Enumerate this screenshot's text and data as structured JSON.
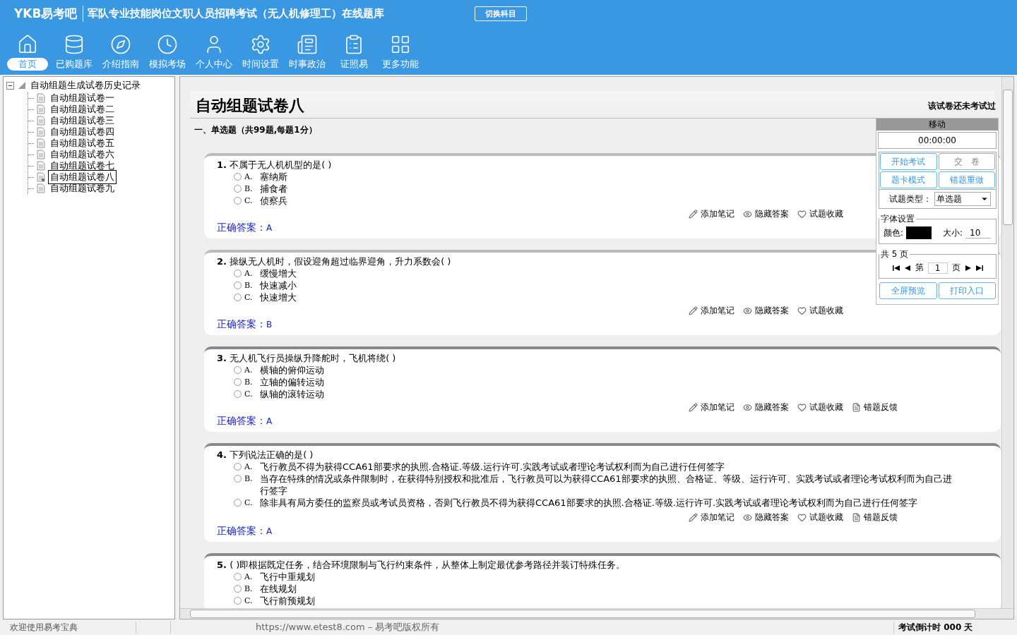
{
  "header": {
    "logo": "YKB易考吧",
    "title": "军队专业技能岗位文职人员招聘考试（无人机修理工）在线题库",
    "switch_button": "切换科目"
  },
  "nav": [
    {
      "label": "首页",
      "selected": true
    },
    {
      "label": "已购题库",
      "selected": false
    },
    {
      "label": "介绍指南",
      "selected": false
    },
    {
      "label": "模拟考场",
      "selected": false
    },
    {
      "label": "个人中心",
      "selected": false
    },
    {
      "label": "时间设置",
      "selected": false
    },
    {
      "label": "时事政治",
      "selected": false
    },
    {
      "label": "证照易",
      "selected": false
    },
    {
      "label": "更多功能",
      "selected": false
    }
  ],
  "tree": {
    "label": "自动组题生成试卷历史记录",
    "expanded": true,
    "children": [
      {
        "label": "自动组题试卷一",
        "selected": false
      },
      {
        "label": "自动组题试卷二",
        "selected": false
      },
      {
        "label": "自动组题试卷三",
        "selected": false
      },
      {
        "label": "自动组题试卷四",
        "selected": false
      },
      {
        "label": "自动组题试卷五",
        "selected": false
      },
      {
        "label": "自动组题试卷六",
        "selected": false
      },
      {
        "label": "自动组题试卷七",
        "selected": false
      },
      {
        "label": "自动组题试卷八",
        "selected": true
      },
      {
        "label": "自动组题试卷九",
        "selected": false
      }
    ]
  },
  "paper": {
    "title": "自动组题试卷八",
    "status": "该试卷还未考试过",
    "section": "一、单选题（共99题,每题1分）"
  },
  "questions": [
    {
      "number": "1.",
      "text": "不属于无人机机型的是( )",
      "options": [
        {
          "letter": "A.",
          "text": "塞纳斯",
          "selected": false
        },
        {
          "letter": "B.",
          "text": "捕食者",
          "selected": false
        },
        {
          "letter": "C.",
          "text": "侦察兵",
          "selected": false
        }
      ],
      "answer_label": "正确答案：",
      "answer": "A",
      "actions": [
        "添加笔记",
        "隐藏答案",
        "试题收藏"
      ]
    },
    {
      "number": "2.",
      "text": "操纵无人机时，假设迎角超过临界迎角，升力系数会( )",
      "options": [
        {
          "letter": "A.",
          "text": "缓慢增大",
          "selected": false
        },
        {
          "letter": "B.",
          "text": "快速减小",
          "selected": false
        },
        {
          "letter": "C.",
          "text": "快速增大",
          "selected": false
        }
      ],
      "answer_label": "正确答案：",
      "answer": "B",
      "actions": [
        "添加笔记",
        "隐藏答案",
        "试题收藏"
      ]
    },
    {
      "number": "3.",
      "text": "无人机飞行员操纵升降舵时，飞机将绕( )",
      "options": [
        {
          "letter": "A.",
          "text": "横轴的俯仰运动",
          "selected": false
        },
        {
          "letter": "B.",
          "text": "立轴的偏转运动",
          "selected": false
        },
        {
          "letter": "C.",
          "text": "纵轴的滚转运动",
          "selected": false
        }
      ],
      "answer_label": "正确答案：",
      "answer": "A",
      "actions": [
        "添加笔记",
        "隐藏答案",
        "试题收藏",
        "错题反馈"
      ]
    },
    {
      "number": "4.",
      "text": "下列说法正确的是( )",
      "options": [
        {
          "letter": "A.",
          "text": "飞行教员不得为获得CCA61部要求的执照.合格证.等级.运行许可.实践考试或者理论考试权利而为自己进行任何签字",
          "selected": false
        },
        {
          "letter": "B.",
          "text": "当存在特殊的情况或条件限制时，在获得特别授权和批准后，飞行教员可以为获得CCA61部要求的执照、合格证、等级、运行许可、实践考试或者理论考试权利而为自己进行签字",
          "selected": false
        },
        {
          "letter": "C.",
          "text": "除非具有局方委任的监察员或考试员资格，否则飞行教员不得为获得CCA61部要求的执照.合格证.等级.运行许可.实践考试或者理论考试权利而为自己进行任何签字",
          "selected": false
        }
      ],
      "answer_label": "正确答案：",
      "answer": "A",
      "actions": [
        "添加笔记",
        "隐藏答案",
        "试题收藏",
        "错题反馈"
      ]
    },
    {
      "number": "5.",
      "text": "( )即根据既定任务，结合环境限制与飞行约束条件，从整体上制定最优参考路径并装订特殊任务。",
      "options": [
        {
          "letter": "A.",
          "text": "飞行中重规划",
          "selected": false
        },
        {
          "letter": "B.",
          "text": "在线规划",
          "selected": false
        },
        {
          "letter": "C.",
          "text": "飞行前预规划",
          "selected": false
        }
      ]
    }
  ],
  "panel": {
    "handle": "移动",
    "timer": "00:00:00",
    "buttons": [
      {
        "label": "开始考试",
        "disabled": false
      },
      {
        "label": "交　卷",
        "disabled": true
      },
      {
        "label": "题卡模式",
        "disabled": false
      },
      {
        "label": "错题重做",
        "disabled": false
      }
    ],
    "type_label": "试题类型：",
    "type_value": "单选题",
    "font_group": "字体设置",
    "color_label": "颜色:",
    "font": {
      "color": "#000000"
    },
    "size_label": "大小:",
    "size_value": "10",
    "pages_group": "共 5 页",
    "page_prefix": "第",
    "page_value": "1",
    "page_suffix": "页",
    "bottom_buttons": [
      "全屏预览",
      "打印入口"
    ]
  },
  "status_bar": {
    "left": "欢迎使用易考宝典",
    "center": "https://www.etest8.com – 易考吧版权所有",
    "right": "考试倒计时 000 天"
  }
}
